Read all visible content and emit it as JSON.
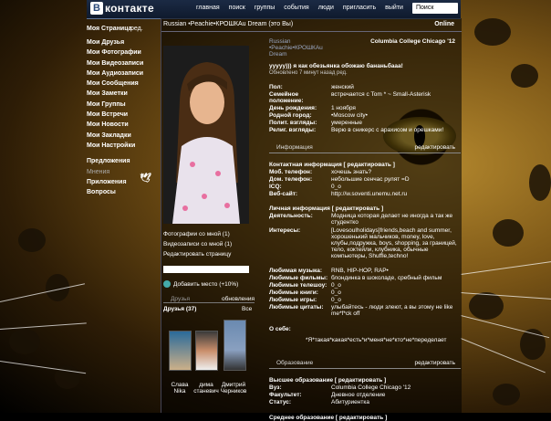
{
  "header": {
    "logo_letter": "B",
    "logo_text": "контакте",
    "nav": [
      "главная",
      "поиск",
      "группы",
      "события",
      "люди",
      "пригласить",
      "выйти"
    ],
    "search_placeholder": "Поиск"
  },
  "sidebar": {
    "items": [
      "Моя Страница",
      "Мои Друзья",
      "Мои Фотографии",
      "Мои Видеозаписи",
      "Мои Аудиозаписи",
      "Мои Сообщения",
      "Мои Заметки",
      "Мои Группы",
      "Мои Встречи",
      "Мои Новости",
      "Мои Закладки",
      "Мои Настройки",
      "Предложения",
      "Мнения",
      "Приложения",
      "Вопросы"
    ],
    "edit_label": "ред."
  },
  "profile": {
    "name_line": "Russian •Peachie•КРОШКАu Dream (это Вы)",
    "online": "Online",
    "name_header": "Russian •Peachie•КРОШКАu Dream",
    "school": "Columbia College Chicago '12",
    "status": "ууууу))) я как обезьянка обожаю бананьбааа!",
    "status_updated": "Обновлено 7 минут назад ред.",
    "rows": [
      {
        "label": "Пол:",
        "value": "женский"
      },
      {
        "label": "Семейное положение:",
        "value": "встречается с Tom * ~ Small-Asterisk"
      },
      {
        "label": "День рождения:",
        "value": "1 ноября"
      },
      {
        "label": "Родной город:",
        "value": "•Moscow city•"
      },
      {
        "label": "Полит. взгляды:",
        "value": "умеренные"
      },
      {
        "label": "Религ. взгляды:",
        "value": "Верю в сникерс с арахисом и орешками!"
      }
    ],
    "contacts_section": "Информация",
    "contacts_edit": "редактировать",
    "contact_header": "Контактная информация [ редактировать ]",
    "contact_rows": [
      {
        "label": "Моб. телефон:",
        "value": "хочешь знать?"
      },
      {
        "label": "Дом. телефон:",
        "value": "небольшие сенчас рулят =D"
      },
      {
        "label": "ICQ:",
        "value": "0_o"
      },
      {
        "label": "Веб-сайт:",
        "value": "http://w.soventi.unemu.net.ru"
      }
    ],
    "personal_header": "Личная информация [ редактировать ]",
    "personal_rows": [
      {
        "label": "Деятельность:",
        "value": "Модница которая делает не иногда а так же студентко"
      },
      {
        "label": "Интересы:",
        "value": "[Lovesoulholidays]friends,beach and summer, хорошенький мальчиков, money, love, клубы,подружка, boys, shopping, за границей, тело, коктейли, клубника, обычные компьютеры, Shuffle,techno!"
      },
      {
        "label": "Любимая музыка:",
        "value": "RNB, HIP-HOP, RAP•"
      },
      {
        "label": "Любимые фильмы:",
        "value": "блондинка в шоколаде, сребный фильм"
      },
      {
        "label": "Любимые телешоу:",
        "value": "0_o"
      },
      {
        "label": "Любимые книги:",
        "value": "0_o"
      },
      {
        "label": "Любимые игры:",
        "value": "0_o"
      },
      {
        "label": "Любимые цитаты:",
        "value": "улыбайтесь - люди злеют, а вы этому не like me*f*ck off"
      },
      {
        "label": "О себе:",
        "value": "*Я*такая*какая*есть*и*меня*не*кто*не*переделает"
      }
    ],
    "education_section": "Образование",
    "education_edit": "редактировать",
    "education_header": "Высшее образование [ редактировать ]",
    "education_rows": [
      {
        "label": "Вуз:",
        "value": "Columbia College Chicago '12"
      },
      {
        "label": "Факультет:",
        "value": "Дневное отделение"
      },
      {
        "label": "Статус:",
        "value": "Абитуриентка"
      }
    ],
    "secondary_header": "Среднее образование [ редактировать ]"
  },
  "left_column": {
    "links": [
      "Фотографии со мной (1)",
      "Видеозаписи со мной (1)",
      "Редактировать страницу"
    ],
    "add_rating": "Добавить место (+10%)",
    "friends_section": "Друзья",
    "friends_update": "обновления",
    "friends_count": "Друзья (37)",
    "friends_all": "Все",
    "friends": [
      {
        "first": "Слава",
        "last": "Nika"
      },
      {
        "first": "дима",
        "last": "станевич"
      },
      {
        "first": "Дмитрий",
        "last": "Черников"
      }
    ]
  },
  "colors": {
    "header": "#1b2a44",
    "panel": "#000000",
    "link": "#ffffff",
    "accent": "#5f7496"
  }
}
